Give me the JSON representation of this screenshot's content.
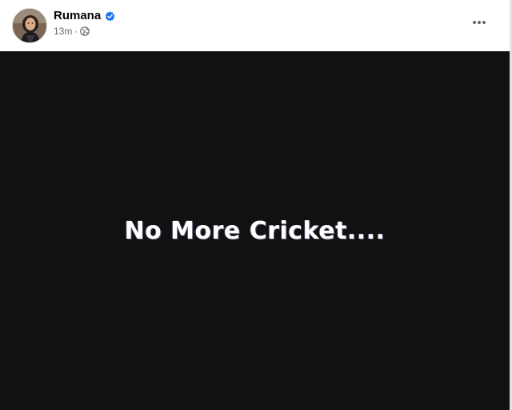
{
  "post": {
    "author": {
      "name": "Rumana",
      "verified_icon": "verified-badge-icon",
      "avatar_icon": "profile-photo"
    },
    "meta": {
      "time": "13m",
      "separator": "·",
      "audience_icon": "globe-icon"
    },
    "menu_icon": "more-options-icon",
    "media_text": "No More Cricket...."
  },
  "colors": {
    "verified": "#1877f2",
    "media_background": "#111111",
    "meta_text": "#65676b",
    "name_text": "#050505"
  }
}
